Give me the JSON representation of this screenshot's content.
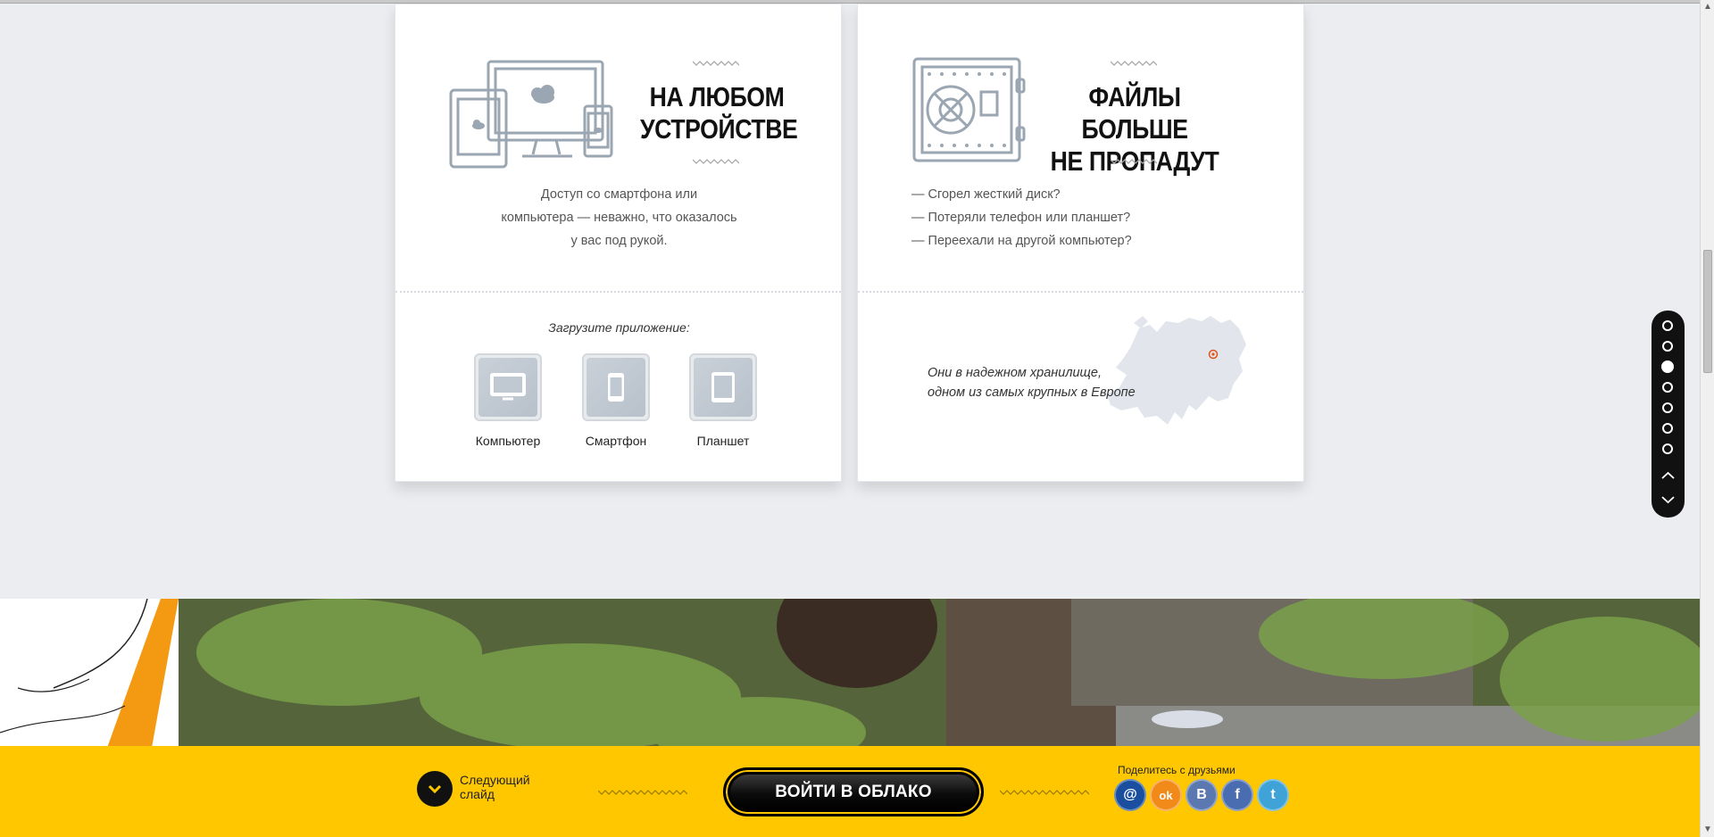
{
  "cards": {
    "devices": {
      "title_line1": "НА ЛЮБОМ",
      "title_line2": "УСТРОЙСТВЕ",
      "desc_lines": [
        "Доступ со смартфона или",
        "компьютера — неважно, что оказалось",
        "у вас под рукой."
      ],
      "download_label": "Загрузите приложение:",
      "downloads": [
        {
          "label": "Компьютер",
          "icon": "monitor-icon"
        },
        {
          "label": "Смартфон",
          "icon": "smartphone-icon"
        },
        {
          "label": "Планшет",
          "icon": "tablet-icon"
        }
      ]
    },
    "safety": {
      "title_line1": "ФАЙЛЫ БОЛЬШЕ",
      "title_line2": "НЕ ПРОПАДУТ",
      "list": [
        "— Сгорел жесткий диск?",
        "— Потеряли телефон или планшет?",
        "— Переехали на другой компьютер?"
      ],
      "europe_line1": "Они в надежном хранилище,",
      "europe_line2": "одном из самых крупных в Европе"
    }
  },
  "slide_nav": {
    "count": 7,
    "active_index": 2
  },
  "footer": {
    "next_label_line1": "Следующий",
    "next_label_line2": "слайд",
    "cta_label": "ВОЙТИ В ОБЛАКО",
    "share_label": "Поделитесь с друзьями",
    "socials": [
      {
        "name": "mail",
        "glyph": "@",
        "color": "#1a4fa0"
      },
      {
        "name": "odnoklassniki",
        "glyph": "ok",
        "color": "#f28a1a"
      },
      {
        "name": "vkontakte",
        "glyph": "В",
        "color": "#5b79b0"
      },
      {
        "name": "facebook",
        "glyph": "f",
        "color": "#4a6cb0"
      },
      {
        "name": "twitter",
        "glyph": "t",
        "color": "#3fa3d8"
      }
    ]
  },
  "colors": {
    "accent": "#ffc700",
    "icon_gray": "#9aa6b2",
    "map_marker": "#e0541a"
  }
}
